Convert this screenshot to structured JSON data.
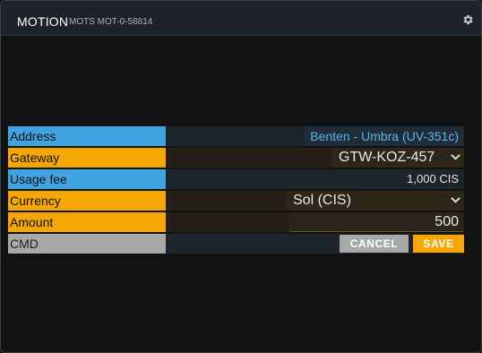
{
  "header": {
    "title": "MOTION",
    "subtitle": "MOTS MOT-0-58814",
    "settings_icon": "gear-icon"
  },
  "form": {
    "address": {
      "label": "Address",
      "value": "Benten - Umbra (UV-351c)"
    },
    "gateway": {
      "label": "Gateway",
      "selected": "GTW-KOZ-457"
    },
    "usage_fee": {
      "label": "Usage fee",
      "value": "1,000 CIS"
    },
    "currency": {
      "label": "Currency",
      "selected": "Sol (CIS)"
    },
    "amount": {
      "label": "Amount",
      "value": "500"
    },
    "cmd": {
      "label": "CMD",
      "cancel_label": "CANCEL",
      "save_label": "SAVE"
    }
  },
  "colors": {
    "info_label": "#41a4e0",
    "input_label": "#f7a703",
    "cmd_label": "#a8a8a8",
    "accent_text": "#5db4ea"
  }
}
